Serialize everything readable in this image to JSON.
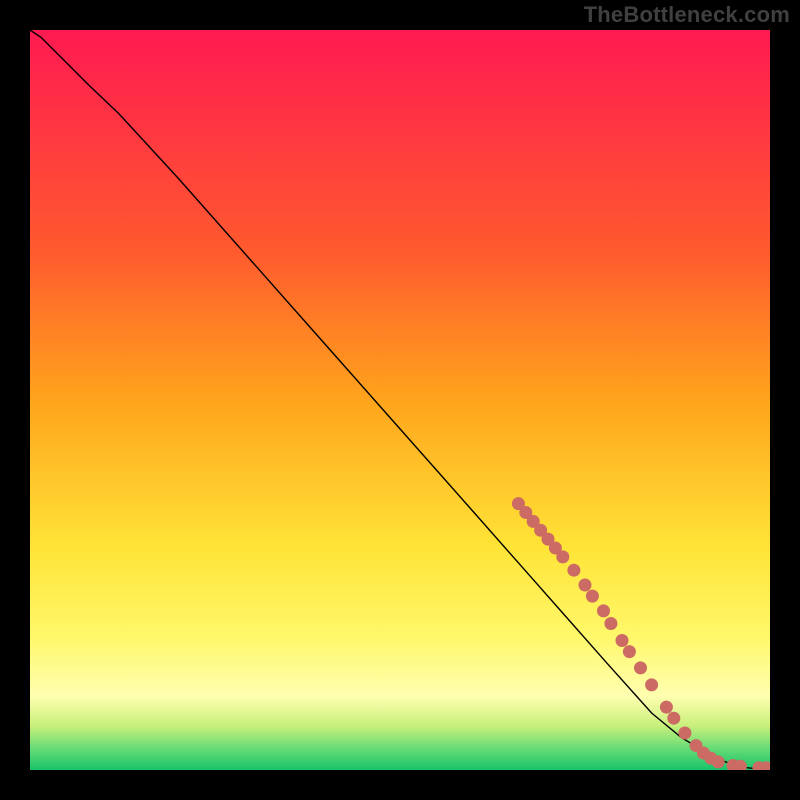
{
  "watermark": "TheBottleneck.com",
  "chart_data": {
    "type": "line",
    "title": "",
    "xlabel": "",
    "ylabel": "",
    "xlim": [
      0,
      100
    ],
    "ylim": [
      0,
      100
    ],
    "grid": false,
    "legend": false,
    "gradient_stops": [
      {
        "offset": 0.0,
        "color": "#ff1a51"
      },
      {
        "offset": 0.3,
        "color": "#ff5a2e"
      },
      {
        "offset": 0.5,
        "color": "#ffa41c"
      },
      {
        "offset": 0.7,
        "color": "#ffe437"
      },
      {
        "offset": 0.82,
        "color": "#fff86a"
      },
      {
        "offset": 0.9,
        "color": "#ffffb0"
      },
      {
        "offset": 0.94,
        "color": "#c9f07c"
      },
      {
        "offset": 0.97,
        "color": "#69dc76"
      },
      {
        "offset": 1.0,
        "color": "#18c36b"
      }
    ],
    "series": [
      {
        "name": "bottleneck-curve",
        "color": "#000000",
        "stroke_width": 1.4,
        "x": [
          0.0,
          1.5,
          3.0,
          5.0,
          8.0,
          12.0,
          20.0,
          30.0,
          40.0,
          50.0,
          60.0,
          66.0,
          72.0,
          78.0,
          84.0,
          88.0,
          91.0,
          93.5,
          95.0,
          97.0,
          99.0,
          100.0
        ],
        "y": [
          100.0,
          99.0,
          97.5,
          95.5,
          92.5,
          88.7,
          80.0,
          68.7,
          57.4,
          46.1,
          34.8,
          28.0,
          21.2,
          14.4,
          7.7,
          4.4,
          2.6,
          1.3,
          0.7,
          0.3,
          0.1,
          0.1
        ]
      }
    ],
    "markers": {
      "name": "dotted-segment",
      "color": "#cc6b63",
      "radius": 6.5,
      "points": [
        {
          "x": 66.0,
          "y": 36.0
        },
        {
          "x": 67.0,
          "y": 34.8
        },
        {
          "x": 68.0,
          "y": 33.6
        },
        {
          "x": 69.0,
          "y": 32.4
        },
        {
          "x": 70.0,
          "y": 31.2
        },
        {
          "x": 71.0,
          "y": 30.0
        },
        {
          "x": 72.0,
          "y": 28.8
        },
        {
          "x": 73.5,
          "y": 27.0
        },
        {
          "x": 75.0,
          "y": 25.0
        },
        {
          "x": 76.0,
          "y": 23.5
        },
        {
          "x": 77.5,
          "y": 21.5
        },
        {
          "x": 78.5,
          "y": 19.8
        },
        {
          "x": 80.0,
          "y": 17.5
        },
        {
          "x": 81.0,
          "y": 16.0
        },
        {
          "x": 82.5,
          "y": 13.8
        },
        {
          "x": 84.0,
          "y": 11.5
        },
        {
          "x": 86.0,
          "y": 8.5
        },
        {
          "x": 87.0,
          "y": 7.0
        },
        {
          "x": 88.5,
          "y": 5.0
        },
        {
          "x": 90.0,
          "y": 3.3
        },
        {
          "x": 91.0,
          "y": 2.3
        },
        {
          "x": 92.0,
          "y": 1.6
        },
        {
          "x": 93.0,
          "y": 1.1
        },
        {
          "x": 95.0,
          "y": 0.6
        },
        {
          "x": 96.0,
          "y": 0.5
        },
        {
          "x": 98.5,
          "y": 0.3
        },
        {
          "x": 99.5,
          "y": 0.3
        }
      ]
    }
  }
}
